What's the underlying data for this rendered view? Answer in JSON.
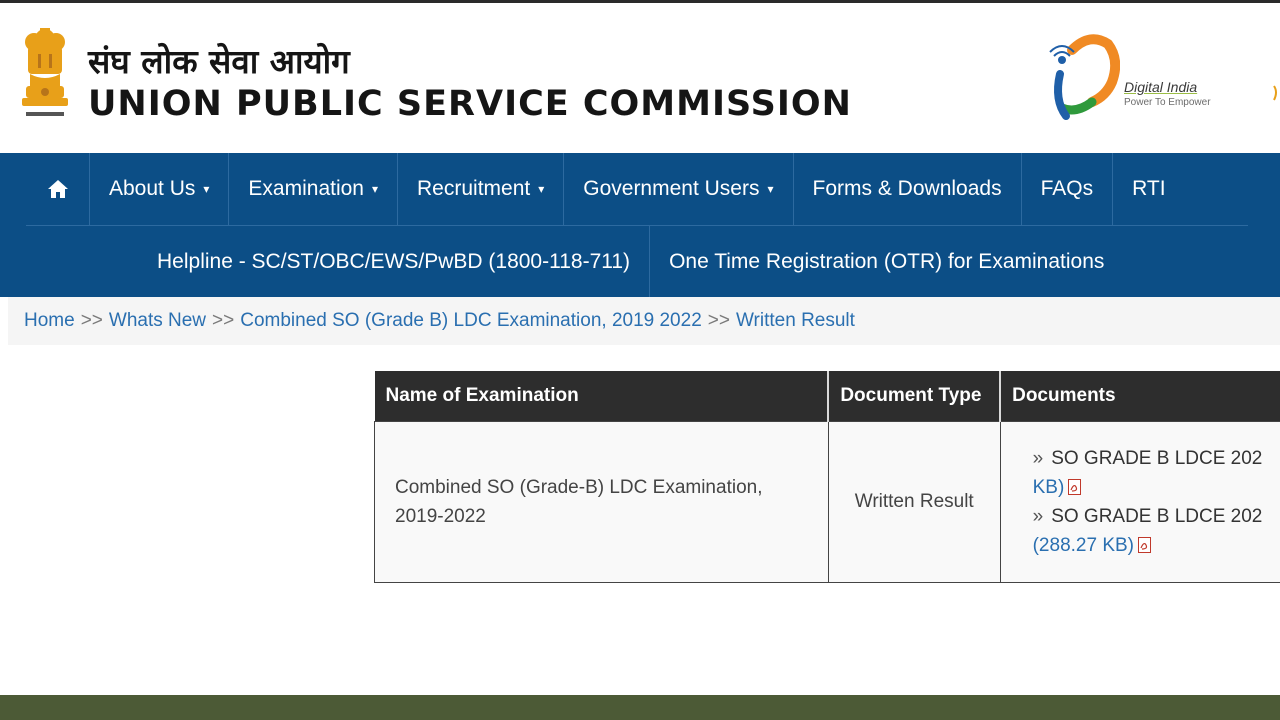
{
  "header": {
    "hindi_title": "संघ लोक सेवा आयोग",
    "english_title": "UNION PUBLIC SERVICE COMMISSION",
    "emblem_icon": "ashoka-emblem-icon",
    "digital_india": {
      "name": "Digital India",
      "tagline": "Power To Empower",
      "icon": "digital-india-logo-icon"
    }
  },
  "nav": {
    "home_icon": "home-icon",
    "items": [
      {
        "label": "About Us",
        "dropdown": true
      },
      {
        "label": "Examination",
        "dropdown": true
      },
      {
        "label": "Recruitment",
        "dropdown": true
      },
      {
        "label": "Government Users",
        "dropdown": true
      },
      {
        "label": "Forms & Downloads",
        "dropdown": false
      },
      {
        "label": "FAQs",
        "dropdown": false
      },
      {
        "label": "RTI",
        "dropdown": false
      }
    ],
    "row2": [
      {
        "label": "Helpline - SC/ST/OBC/EWS/PwBD (1800-118-711)"
      },
      {
        "label": "One Time Registration (OTR) for Examinations"
      }
    ],
    "caret": "▾"
  },
  "breadcrumb": {
    "items": [
      "Home",
      "Whats New",
      "Combined SO (Grade B) LDC Examination, 2019 2022",
      "Written Result"
    ],
    "separator": ">>"
  },
  "table": {
    "headers": [
      "Name of Examination",
      "Document Type",
      "Documents"
    ],
    "rows": [
      {
        "name_line1": "Combined SO (Grade-B) LDC Examination,",
        "name_line2": "2019-2022",
        "type": "Written Result",
        "documents": [
          {
            "title": "SO GRADE B LDCE 202",
            "size": "KB)"
          },
          {
            "title": "SO GRADE B LDCE 202",
            "size": "(288.27 KB)"
          }
        ],
        "bullet": "»"
      }
    ]
  },
  "colors": {
    "nav_bg": "#0c4e86",
    "table_header_bg": "#2d2d2d",
    "link": "#2a6fb0",
    "footer": "#4c5a36"
  }
}
